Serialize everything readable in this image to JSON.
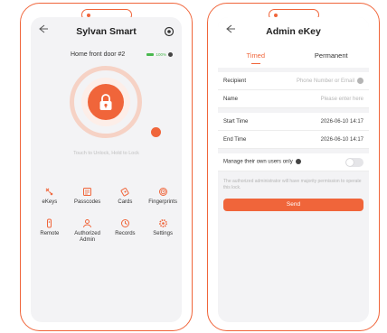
{
  "left": {
    "title": "Sylvan Smart",
    "device_name": "Home front door #2",
    "battery_text": "100%",
    "hint": "Touch to Unlock, Hold to Lock",
    "features": [
      {
        "label": "eKeys",
        "icon": "ekey-icon"
      },
      {
        "label": "Passcodes",
        "icon": "passcode-icon"
      },
      {
        "label": "Cards",
        "icon": "card-icon"
      },
      {
        "label": "Fingerprints",
        "icon": "fingerprint-icon"
      },
      {
        "label": "Remote",
        "icon": "remote-icon"
      },
      {
        "label": "Authorized Admin",
        "icon": "admin-icon"
      },
      {
        "label": "Records",
        "icon": "records-icon"
      },
      {
        "label": "Settings",
        "icon": "settings-icon"
      }
    ]
  },
  "right": {
    "title": "Admin eKey",
    "tabs": [
      {
        "label": "Timed",
        "active": true
      },
      {
        "label": "Permanent",
        "active": false
      }
    ],
    "recipient_label": "Recipient",
    "recipient_placeholder": "Phone Number or Email",
    "name_label": "Name",
    "name_placeholder": "Please enter here",
    "start_label": "Start Time",
    "start_value": "2026-06-10 14:17",
    "end_label": "End Time",
    "end_value": "2026-06-10 14:17",
    "manage_label": "Manage their own users only",
    "note": "The authorized administrator will have majority permission to operate this lock.",
    "send_label": "Send"
  },
  "colors": {
    "accent": "#f0653a",
    "battery": "#49b84f",
    "background": "#f3f3f5"
  }
}
